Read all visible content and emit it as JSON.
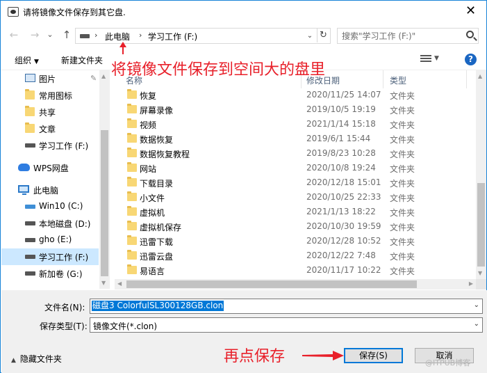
{
  "window": {
    "title": "请将镜像文件保存到其它盘.",
    "close_glyph": "✕"
  },
  "nav": {
    "back": "←",
    "forward": "→",
    "recent": "⌄",
    "up": "↑",
    "breadcrumb": [
      "此电脑",
      "学习工作 (F:)"
    ],
    "refresh": "↻",
    "search_placeholder": "搜索\"学习工作 (F:)\""
  },
  "toolbar": {
    "organize": "组织",
    "new_folder": "新建文件夹",
    "help": "?"
  },
  "sidebar": {
    "items": [
      {
        "label": "图片",
        "icon": "pictures-icon",
        "pinned": true
      },
      {
        "label": "常用图标",
        "icon": "folder-icon"
      },
      {
        "label": "共享",
        "icon": "folder-icon"
      },
      {
        "label": "文章",
        "icon": "folder-icon"
      },
      {
        "label": "学习工作 (F:)",
        "icon": "drive-icon"
      },
      {
        "label": "WPS网盘",
        "icon": "cloud-icon"
      },
      {
        "label": "此电脑",
        "icon": "pc-icon"
      },
      {
        "label": "Win10 (C:)",
        "icon": "windows-drive-icon"
      },
      {
        "label": "本地磁盘 (D:)",
        "icon": "drive-icon"
      },
      {
        "label": "gho (E:)",
        "icon": "drive-icon"
      },
      {
        "label": "学习工作 (F:)",
        "icon": "drive-icon",
        "selected": true
      },
      {
        "label": "新加卷 (G:)",
        "icon": "drive-icon"
      }
    ]
  },
  "filelist": {
    "columns": {
      "name": "名称",
      "date": "修改日期",
      "type": "类型"
    },
    "rows": [
      {
        "name": "恢复",
        "date": "2020/11/25 14:07",
        "type": "文件夹"
      },
      {
        "name": "屏幕录像",
        "date": "2019/10/5 19:19",
        "type": "文件夹"
      },
      {
        "name": "视频",
        "date": "2021/1/14 15:18",
        "type": "文件夹"
      },
      {
        "name": "数据恢复",
        "date": "2019/6/1 15:44",
        "type": "文件夹"
      },
      {
        "name": "数据恢复教程",
        "date": "2019/8/23 10:28",
        "type": "文件夹"
      },
      {
        "name": "网站",
        "date": "2020/10/8 19:24",
        "type": "文件夹"
      },
      {
        "name": "下载目录",
        "date": "2020/12/18 15:01",
        "type": "文件夹"
      },
      {
        "name": "小文件",
        "date": "2020/10/25 22:33",
        "type": "文件夹"
      },
      {
        "name": "虚拟机",
        "date": "2021/1/13 18:22",
        "type": "文件夹"
      },
      {
        "name": "虚拟机保存",
        "date": "2020/10/30 19:59",
        "type": "文件夹"
      },
      {
        "name": "迅雷下载",
        "date": "2020/12/28 10:52",
        "type": "文件夹"
      },
      {
        "name": "迅雷云盘",
        "date": "2020/12/22 7:48",
        "type": "文件夹"
      },
      {
        "name": "易语言",
        "date": "2020/11/17 10:22",
        "type": "文件夹"
      }
    ]
  },
  "form": {
    "filename_label": "文件名(N):",
    "filename_value": "磁盘3 ColorfulSL300128GB.clon",
    "filetype_label": "保存类型(T):",
    "filetype_value": "镜像文件(*.clon)",
    "hide_folders": "隐藏文件夹",
    "save": "保存(S)",
    "cancel": "取消"
  },
  "annotations": {
    "top": "将镜像文件保存到空间大的盘里",
    "bottom": "再点保存",
    "watermark": "@ITPUB博客"
  },
  "colors": {
    "annotation": "#e8202a",
    "selection": "#0078d7",
    "sidebar_selected": "#cce8ff"
  }
}
